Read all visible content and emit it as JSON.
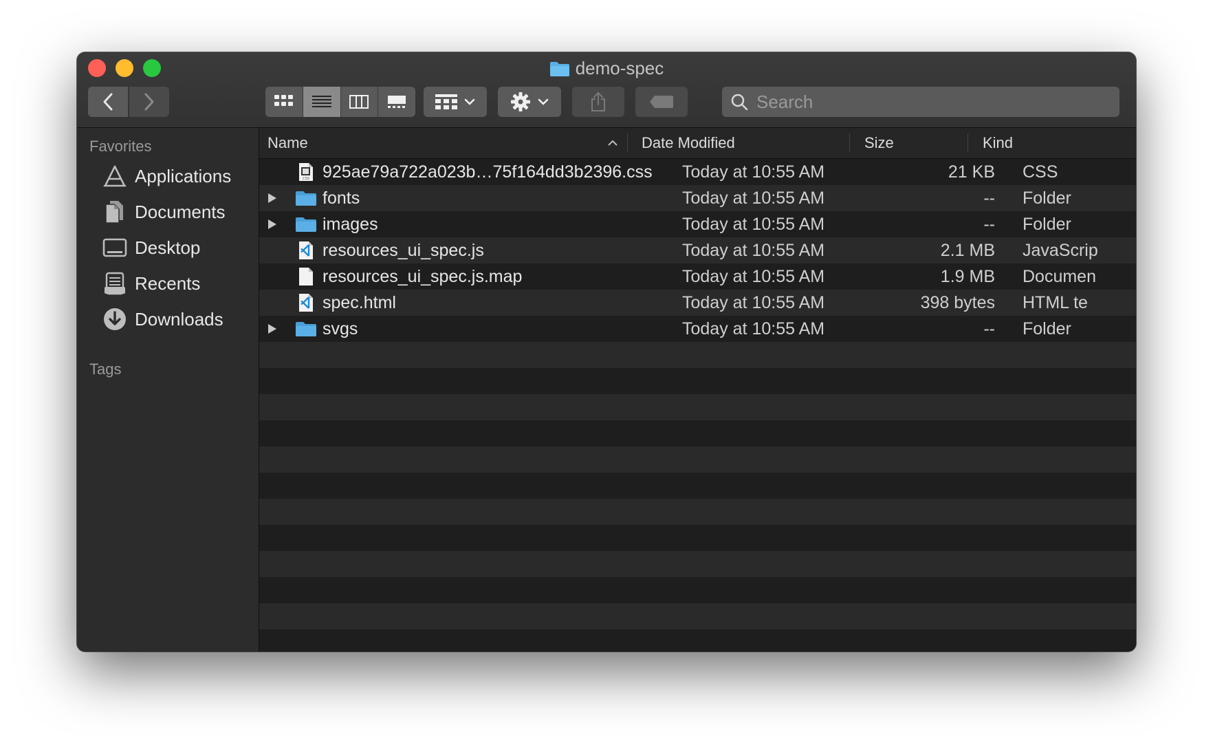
{
  "window": {
    "title": "demo-spec"
  },
  "toolbar": {
    "back_icon": "chevron-left-icon",
    "forward_icon": "chevron-right-icon",
    "view_modes": [
      "icon-view-icon",
      "list-view-icon",
      "column-view-icon",
      "gallery-view-icon"
    ],
    "active_view": "list",
    "search_placeholder": "Search"
  },
  "sidebar": {
    "favorites_heading": "Favorites",
    "items": [
      {
        "label": "Applications",
        "icon": "applications-icon"
      },
      {
        "label": "Documents",
        "icon": "documents-icon"
      },
      {
        "label": "Desktop",
        "icon": "desktop-icon"
      },
      {
        "label": "Recents",
        "icon": "recents-icon"
      },
      {
        "label": "Downloads",
        "icon": "downloads-icon"
      }
    ],
    "tags_heading": "Tags"
  },
  "columns": {
    "name": "Name",
    "date": "Date Modified",
    "size": "Size",
    "kind": "Kind"
  },
  "files": [
    {
      "name": "925ae79a722a023b…75f164dd3b2396.css",
      "date": "Today at 10:55 AM",
      "size": "21 KB",
      "kind": "CSS",
      "icon": "css-file-icon",
      "folder": false
    },
    {
      "name": "fonts",
      "date": "Today at 10:55 AM",
      "size": "--",
      "kind": "Folder",
      "icon": "folder-icon",
      "folder": true
    },
    {
      "name": "images",
      "date": "Today at 10:55 AM",
      "size": "--",
      "kind": "Folder",
      "icon": "folder-icon",
      "folder": true
    },
    {
      "name": "resources_ui_spec.js",
      "date": "Today at 10:55 AM",
      "size": "2.1 MB",
      "kind": "JavaScrip",
      "icon": "vscode-file-icon",
      "folder": false
    },
    {
      "name": "resources_ui_spec.js.map",
      "date": "Today at 10:55 AM",
      "size": "1.9 MB",
      "kind": "Documen",
      "icon": "document-file-icon",
      "folder": false
    },
    {
      "name": "spec.html",
      "date": "Today at 10:55 AM",
      "size": "398 bytes",
      "kind": "HTML te",
      "icon": "vscode-file-icon",
      "folder": false
    },
    {
      "name": "svgs",
      "date": "Today at 10:55 AM",
      "size": "--",
      "kind": "Folder",
      "icon": "folder-icon",
      "folder": true
    }
  ],
  "colors": {
    "folder_blue": "#5ab0e6",
    "close": "#fe5f57",
    "minimize": "#febc2e",
    "maximize": "#28c840"
  }
}
